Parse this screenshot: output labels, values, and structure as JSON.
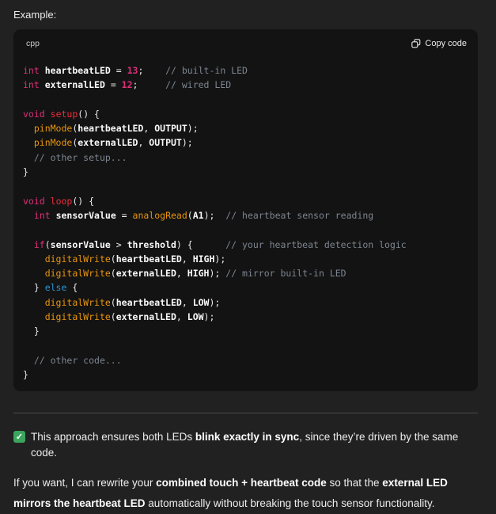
{
  "colors": {
    "page_bg": "#212121",
    "code_bg": "#131313",
    "text_main": "#ececec",
    "check_green": "#3ba55d",
    "token_colors": {
      "p": "#ececec",
      "v": "#fafafa",
      "t": "#df3079",
      "n": "#df3079",
      "f": "#f22c3d",
      "b": "#e9950c",
      "k": "#2e95d3",
      "c": "#7d8590"
    }
  },
  "intro": {
    "label": "Example:"
  },
  "code_block": {
    "language_label": "cpp",
    "copy_button_label": "Copy code",
    "lines": [
      [
        [
          "t",
          "int"
        ],
        [
          "p",
          " "
        ],
        [
          "v",
          "heartbeatLED"
        ],
        [
          "p",
          " = "
        ],
        [
          "n",
          "13"
        ],
        [
          "p",
          ";    "
        ],
        [
          "c",
          "// built-in LED"
        ]
      ],
      [
        [
          "t",
          "int"
        ],
        [
          "p",
          " "
        ],
        [
          "v",
          "externalLED"
        ],
        [
          "p",
          " = "
        ],
        [
          "n",
          "12"
        ],
        [
          "p",
          ";     "
        ],
        [
          "c",
          "// wired LED"
        ]
      ],
      [],
      [
        [
          "t",
          "void"
        ],
        [
          "p",
          " "
        ],
        [
          "f",
          "setup"
        ],
        [
          "p",
          "() {"
        ]
      ],
      [
        [
          "p",
          "  "
        ],
        [
          "b",
          "pinMode"
        ],
        [
          "p",
          "("
        ],
        [
          "v",
          "heartbeatLED"
        ],
        [
          "p",
          ", "
        ],
        [
          "v",
          "OUTPUT"
        ],
        [
          "p",
          ");"
        ]
      ],
      [
        [
          "p",
          "  "
        ],
        [
          "b",
          "pinMode"
        ],
        [
          "p",
          "("
        ],
        [
          "v",
          "externalLED"
        ],
        [
          "p",
          ", "
        ],
        [
          "v",
          "OUTPUT"
        ],
        [
          "p",
          ");"
        ]
      ],
      [
        [
          "p",
          "  "
        ],
        [
          "c",
          "// other setup..."
        ]
      ],
      [
        [
          "p",
          "}"
        ]
      ],
      [],
      [
        [
          "t",
          "void"
        ],
        [
          "p",
          " "
        ],
        [
          "f",
          "loop"
        ],
        [
          "p",
          "() {"
        ]
      ],
      [
        [
          "p",
          "  "
        ],
        [
          "t",
          "int"
        ],
        [
          "p",
          " "
        ],
        [
          "v",
          "sensorValue"
        ],
        [
          "p",
          " = "
        ],
        [
          "b",
          "analogRead"
        ],
        [
          "p",
          "("
        ],
        [
          "v",
          "A1"
        ],
        [
          "p",
          ");  "
        ],
        [
          "c",
          "// heartbeat sensor reading"
        ]
      ],
      [],
      [
        [
          "p",
          "  "
        ],
        [
          "t",
          "if"
        ],
        [
          "p",
          "("
        ],
        [
          "v",
          "sensorValue"
        ],
        [
          "p",
          " > "
        ],
        [
          "v",
          "threshold"
        ],
        [
          "p",
          ") {      "
        ],
        [
          "c",
          "// your heartbeat detection logic"
        ]
      ],
      [
        [
          "p",
          "    "
        ],
        [
          "b",
          "digitalWrite"
        ],
        [
          "p",
          "("
        ],
        [
          "v",
          "heartbeatLED"
        ],
        [
          "p",
          ", "
        ],
        [
          "v",
          "HIGH"
        ],
        [
          "p",
          ");"
        ]
      ],
      [
        [
          "p",
          "    "
        ],
        [
          "b",
          "digitalWrite"
        ],
        [
          "p",
          "("
        ],
        [
          "v",
          "externalLED"
        ],
        [
          "p",
          ", "
        ],
        [
          "v",
          "HIGH"
        ],
        [
          "p",
          ");"
        ],
        [
          "p",
          " "
        ],
        [
          "c",
          "// mirror built-in LED"
        ]
      ],
      [
        [
          "p",
          "  } "
        ],
        [
          "k",
          "else"
        ],
        [
          "p",
          " {"
        ]
      ],
      [
        [
          "p",
          "    "
        ],
        [
          "b",
          "digitalWrite"
        ],
        [
          "p",
          "("
        ],
        [
          "v",
          "heartbeatLED"
        ],
        [
          "p",
          ", "
        ],
        [
          "v",
          "LOW"
        ],
        [
          "p",
          ");"
        ]
      ],
      [
        [
          "p",
          "    "
        ],
        [
          "b",
          "digitalWrite"
        ],
        [
          "p",
          "("
        ],
        [
          "v",
          "externalLED"
        ],
        [
          "p",
          ", "
        ],
        [
          "v",
          "LOW"
        ],
        [
          "p",
          ");"
        ]
      ],
      [
        [
          "p",
          "  }"
        ]
      ],
      [],
      [
        [
          "p",
          "  "
        ],
        [
          "c",
          "// other code..."
        ]
      ],
      [
        [
          "p",
          "}"
        ]
      ]
    ]
  },
  "check_line": {
    "emoji": "check-mark-emoji",
    "check_glyph": "✓",
    "segments": [
      [
        "p",
        "This approach ensures both LEDs "
      ],
      [
        "b",
        "blink exactly in sync"
      ],
      [
        "p",
        ", since they’re driven by the same code."
      ]
    ]
  },
  "closing": {
    "segments": [
      [
        "p",
        "If you want, I can rewrite your "
      ],
      [
        "b",
        "combined touch + heartbeat code"
      ],
      [
        "p",
        " so that the "
      ],
      [
        "b",
        "external LED mirrors the heartbeat LED"
      ],
      [
        "p",
        " automatically without breaking the touch sensor functionality."
      ]
    ]
  }
}
